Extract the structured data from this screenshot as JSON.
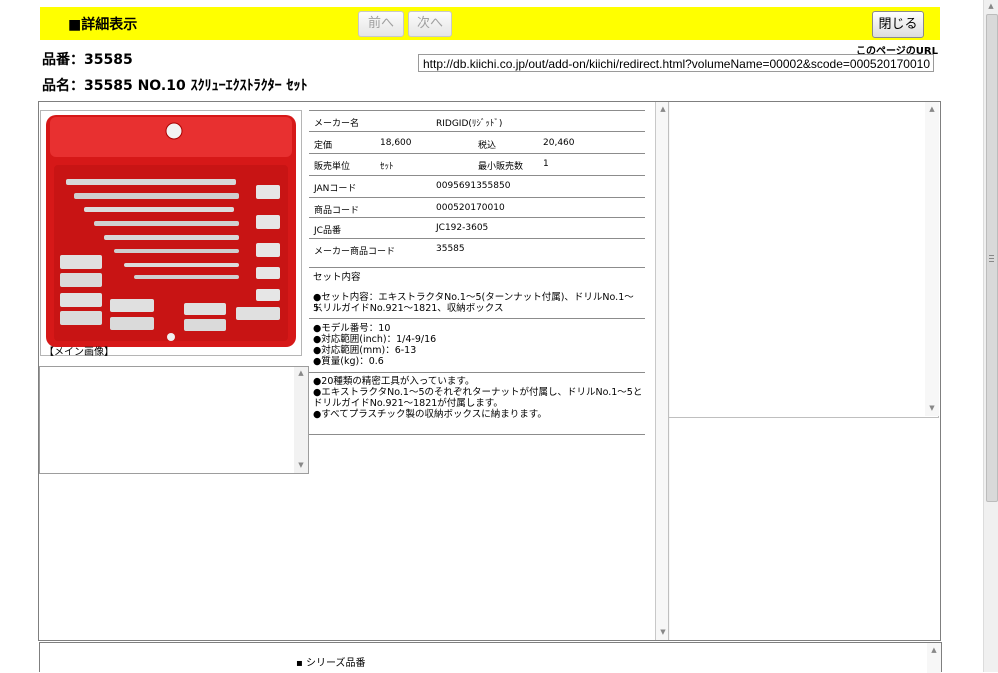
{
  "header": {
    "title": "■詳細表示",
    "prev_label": "前へ",
    "next_label": "次へ",
    "close_label": "閉じる"
  },
  "url_section": {
    "label": "このページのURL",
    "url": "http://db.kiichi.co.jp/out/add-on/kiichi/redirect.html?volumeName=00002&scode=000520170010"
  },
  "product": {
    "number_line": "品番：35585",
    "name_line": "品名：35585 NO.10 ｽｸﾘｭｰｴｸｽﾄﾗｸﾀｰ ｾｯﾄ",
    "image_caption": "【メイン画像】"
  },
  "specs": {
    "maker_label": "メーカー名",
    "maker_value": "RIDGID(ﾘｼﾞｯﾄﾞ)",
    "list_price_label": "定価",
    "list_price_value": "18,600",
    "tax_incl_label": "税込",
    "tax_incl_value": "20,460",
    "sales_unit_label": "販売単位",
    "sales_unit_value": "ｾｯﾄ",
    "min_qty_label": "最小販売数",
    "min_qty_value": "1",
    "jan_label": "JANコード",
    "jan_value": "0095691355850",
    "product_code_label": "商品コード",
    "product_code_value": "000520170010",
    "jc_label": "JC品番",
    "jc_value": "JC192-3605",
    "maker_code_label": "メーカー商品コード",
    "maker_code_value": "35585"
  },
  "contents": {
    "heading": "セット内容",
    "set_line1": "●セット内容：エキストラクタNo.1～5(ターンナット付属)、ドリルNo.1～5、",
    "set_line2": "ドリルガイドNo.921～1821、収納ボックス",
    "model": "●モデル番号：10",
    "range_inch": "●対応範囲(inch)：1/4-9/16",
    "range_mm": "●対応範囲(mm)：6-13",
    "weight": "●質量(kg)：0.6",
    "feature1": "●20種類の精密工具が入っています。",
    "feature2a": "●エキストラクタNo.1～5のそれぞれターナットが付属し、ドリルNo.1～5と",
    "feature2b": "ドリルガイドNo.921～1821が付属します。",
    "feature3": "●すべてプラスチック製の収納ボックスに納まります。"
  },
  "series": {
    "label": "シリーズ品番"
  },
  "colors": {
    "header_bg": "#ffff00",
    "case_red": "#e02020"
  }
}
